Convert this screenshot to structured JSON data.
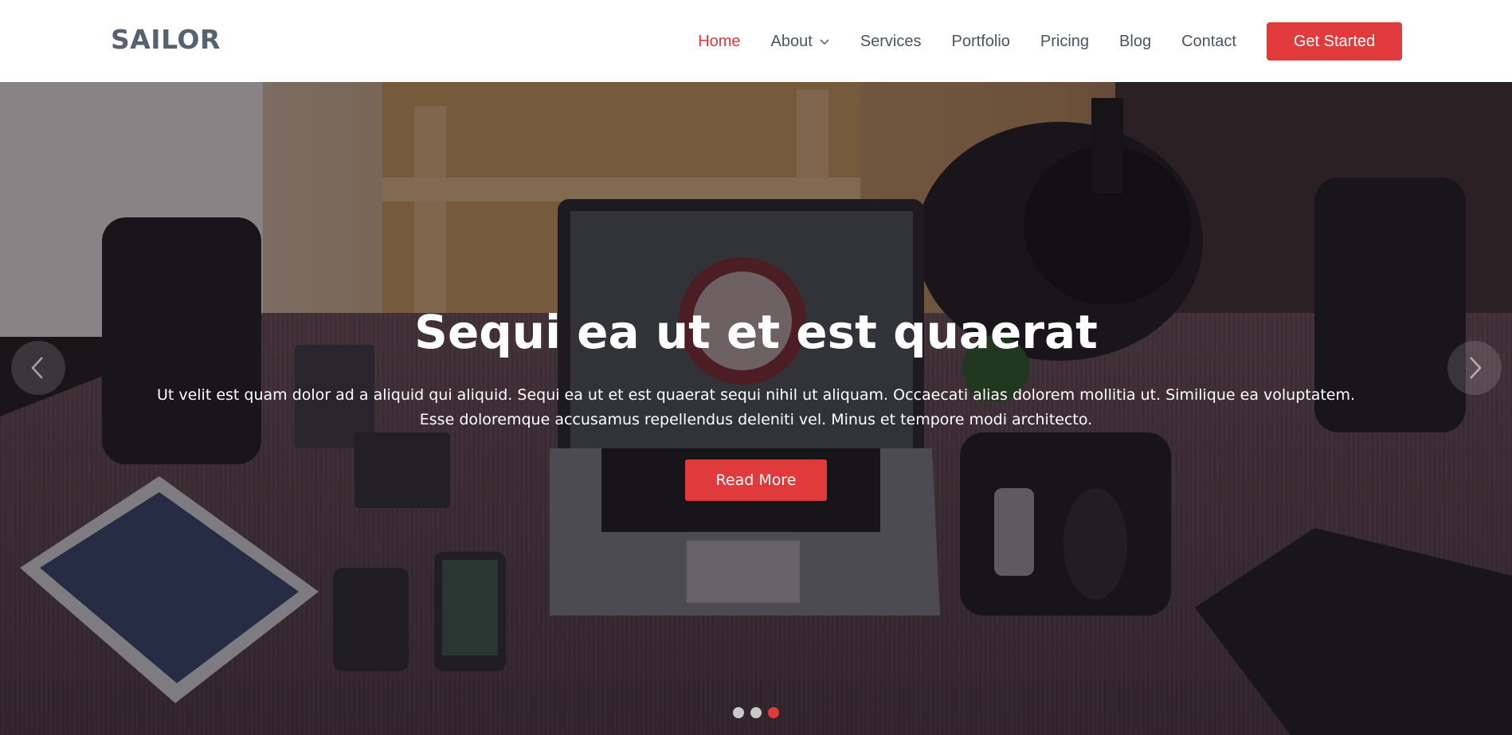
{
  "header": {
    "logo": "SAILOR",
    "nav": [
      {
        "label": "Home",
        "active": true
      },
      {
        "label": "About",
        "active": false,
        "has_dropdown": true
      },
      {
        "label": "Services",
        "active": false
      },
      {
        "label": "Portfolio",
        "active": false
      },
      {
        "label": "Pricing",
        "active": false
      },
      {
        "label": "Blog",
        "active": false
      },
      {
        "label": "Contact",
        "active": false
      }
    ],
    "cta_label": "Get Started"
  },
  "hero": {
    "title": "Sequi ea ut et est quaerat",
    "text": "Ut velit est quam dolor ad a aliquid qui aliquid. Sequi ea ut et est quaerat sequi nihil ut aliquam. Occaecati alias dolorem mollitia ut. Similique ea voluptatem. Esse doloremque accusamus repellendus deleniti vel. Minus et tempore modi architecto.",
    "button_label": "Read More",
    "slides_count": 3,
    "active_slide": 3
  },
  "icons": {
    "prev": "chevron-left-icon",
    "next": "chevron-right-icon",
    "dropdown": "chevron-down-icon"
  },
  "colors": {
    "accent": "#e03a3c",
    "logo": "#556270",
    "nav_text": "#4a5560",
    "header_bg": "#ffffff"
  }
}
